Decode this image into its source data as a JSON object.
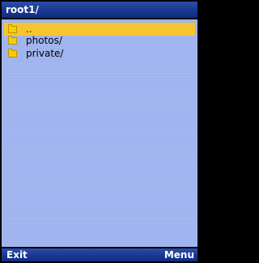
{
  "title_bar": {
    "title": "root1/"
  },
  "file_list": {
    "items": [
      {
        "label": "..",
        "icon": "folder-icon",
        "selected": true
      },
      {
        "label": "photos/",
        "icon": "folder-icon",
        "selected": false
      },
      {
        "label": "private/",
        "icon": "folder-icon",
        "selected": false
      }
    ]
  },
  "softkeys": {
    "left_label": "Exit",
    "right_label": "Menu"
  },
  "colors": {
    "title_bar": "#1a3791",
    "list_background": "#a3b6f0",
    "selection": "#f7c431",
    "folder": "#f5d000"
  }
}
